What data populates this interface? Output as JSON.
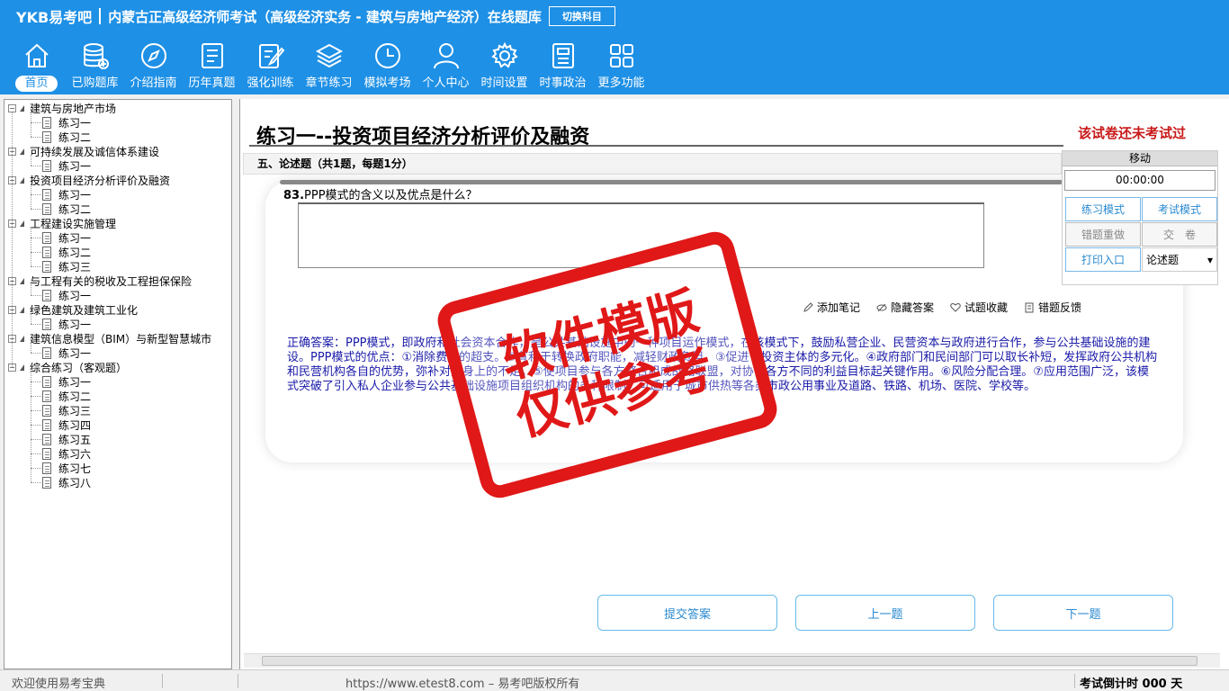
{
  "header": {
    "brand": "YKB易考吧",
    "title": "内蒙古正高级经济师考试（高级经济实务 - 建筑与房地产经济）在线题库",
    "switch_label": "切换科目",
    "nav": [
      {
        "label": "首页",
        "icon": "home-icon"
      },
      {
        "label": "已购题库",
        "icon": "database-icon"
      },
      {
        "label": "介绍指南",
        "icon": "compass-icon"
      },
      {
        "label": "历年真题",
        "icon": "list-icon"
      },
      {
        "label": "强化训练",
        "icon": "edit-icon"
      },
      {
        "label": "章节练习",
        "icon": "layers-icon"
      },
      {
        "label": "模拟考场",
        "icon": "clock-icon"
      },
      {
        "label": "个人中心",
        "icon": "user-icon"
      },
      {
        "label": "时间设置",
        "icon": "gear-icon"
      },
      {
        "label": "时事政治",
        "icon": "newspaper-icon"
      },
      {
        "label": "更多功能",
        "icon": "grid-icon"
      }
    ]
  },
  "sidebar": {
    "groups": [
      {
        "label": "建筑与房地产市场",
        "items": [
          "练习一",
          "练习二"
        ]
      },
      {
        "label": "可持续发展及诚信体系建设",
        "items": [
          "练习一"
        ]
      },
      {
        "label": "投资项目经济分析评价及融资",
        "items": [
          "练习一",
          "练习二"
        ]
      },
      {
        "label": "工程建设实施管理",
        "items": [
          "练习一",
          "练习二",
          "练习三"
        ]
      },
      {
        "label": "与工程有关的税收及工程担保保险",
        "items": [
          "练习一"
        ]
      },
      {
        "label": "绿色建筑及建筑工业化",
        "items": [
          "练习一"
        ]
      },
      {
        "label": "建筑信息模型（BIM）与新型智慧城市",
        "items": [
          "练习一"
        ]
      },
      {
        "label": "综合练习（客观题）",
        "items": [
          "练习一",
          "练习二",
          "练习三",
          "练习四",
          "练习五",
          "练习六",
          "练习七",
          "练习八"
        ]
      }
    ]
  },
  "main": {
    "page_title": "练习一--投资项目经济分析评价及融资",
    "exam_status": "该试卷还未考试过",
    "section": "五、论述题（共1题，每题1分）",
    "question_number": "83.",
    "question_text": "PPP模式的含义以及优点是什么？",
    "answer_value": "",
    "tools": [
      "添加笔记",
      "隐藏答案",
      "试题收藏",
      "错题反馈"
    ],
    "answer_text": "正确答案：PPP模式，即政府和社会资本合作，是公共基础设施中的一种项目运作模式，在该模式下，鼓励私营企业、民营资本与政府进行合作，参与公共基础设施的建设。PPP模式的优点：①消除费用的超支。②有利于转换政府职能，减轻财政负担。③促进了投资主体的多元化。④政府部门和民间部门可以取长补短，发挥政府公共机构和民营机构各自的优势，弥补对方身上的不足。⑤使项目参与各方整合组成战略联盟，对协调各方不同的利益目标起关键作用。⑥风险分配合理。⑦应用范围广泛，该模式突破了引入私人企业参与公共基础设施项目组织机构的多种限制，可适用于城市供热等各类市政公用事业及道路、铁路、机场、医院、学校等。",
    "buttons": {
      "submit": "提交答案",
      "prev": "上一题",
      "next": "下一题"
    }
  },
  "panel": {
    "move_label": "移动",
    "timer": "00:00:00",
    "practice_mode": "练习模式",
    "exam_mode": "考试模式",
    "redo_wrong": "错题重做",
    "hand_in": "交　卷",
    "print_entry": "打印入口",
    "question_type": "论述题"
  },
  "stamp": {
    "line1": "软件模版",
    "line2": "仅供参考"
  },
  "status": {
    "welcome": "欢迎使用易考宝典",
    "url": "https://www.etest8.com – 易考吧版权所有",
    "countdown": "考试倒计时 000 天"
  },
  "colors": {
    "header_bg": "#1e90e6",
    "accent": "#2a8ad0",
    "answer": "#1a1aa8",
    "warning": "#c81818",
    "stamp": "#e01818"
  }
}
